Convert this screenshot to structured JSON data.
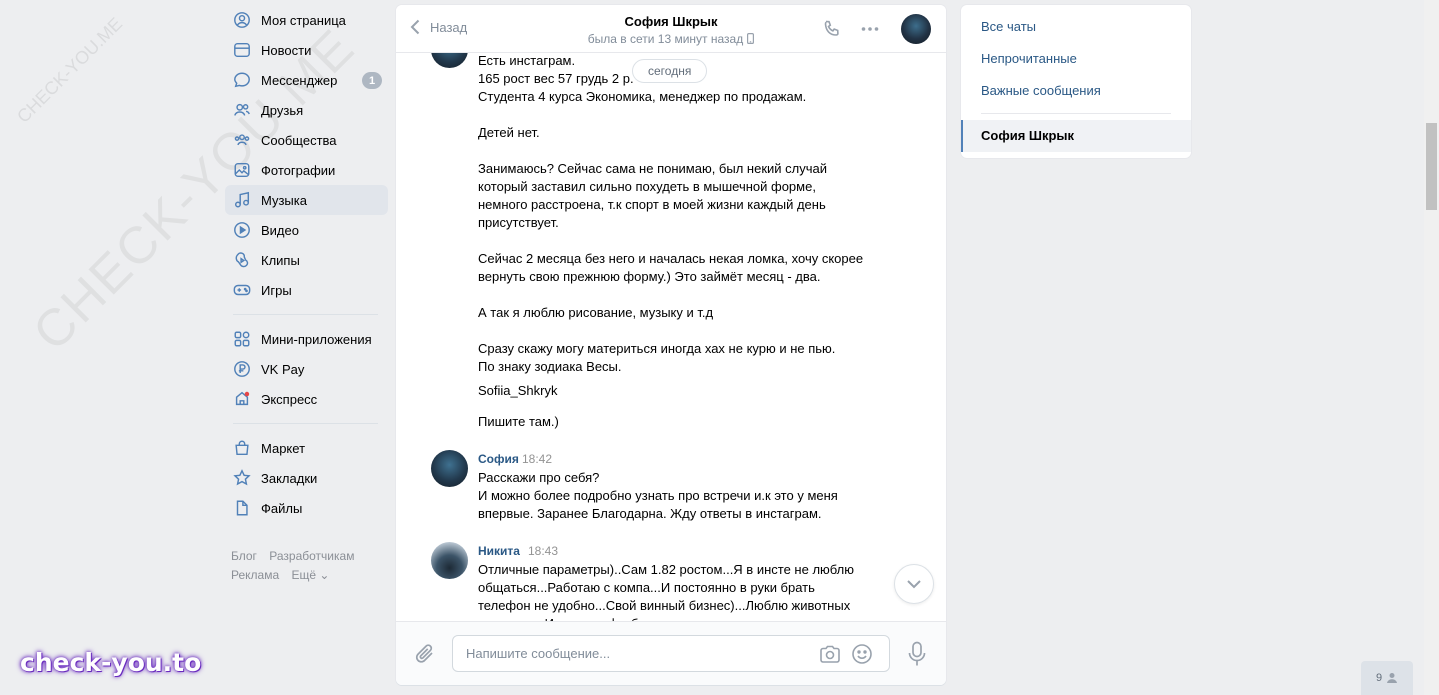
{
  "nav": {
    "items": [
      {
        "label": "Моя страница",
        "icon": "user-circle-icon"
      },
      {
        "label": "Новости",
        "icon": "news-icon"
      },
      {
        "label": "Мессенджер",
        "icon": "chat-icon",
        "badge": "1"
      },
      {
        "label": "Друзья",
        "icon": "friends-icon"
      },
      {
        "label": "Сообщества",
        "icon": "communities-icon"
      },
      {
        "label": "Фотографии",
        "icon": "photo-icon"
      },
      {
        "label": "Музыка",
        "icon": "music-icon"
      },
      {
        "label": "Видео",
        "icon": "video-icon"
      },
      {
        "label": "Клипы",
        "icon": "clips-icon"
      },
      {
        "label": "Игры",
        "icon": "gamepad-icon"
      }
    ],
    "items2": [
      {
        "label": "Мини-приложения",
        "icon": "apps-icon"
      },
      {
        "label": "VK Pay",
        "icon": "vkpay-icon"
      },
      {
        "label": "Экспресс",
        "icon": "express-icon"
      }
    ],
    "items3": [
      {
        "label": "Маркет",
        "icon": "market-icon"
      },
      {
        "label": "Закладки",
        "icon": "star-icon"
      },
      {
        "label": "Файлы",
        "icon": "file-icon"
      }
    ],
    "active": "Музыка",
    "footer": {
      "blog": "Блог",
      "dev": "Разработчикам",
      "ads": "Реклама",
      "more": "Ещё"
    }
  },
  "watermarks": {
    "big": "CHECK-YOU.ME",
    "small": "CHECK-YOU.ME",
    "brand": "check-you.to"
  },
  "chat": {
    "back_label": "Назад",
    "peer_name": "София Шкрык",
    "peer_status": "была в сети 13 минут назад",
    "date_pill": "сегодня",
    "first_message_lines": [
      "Есть инстаграм.",
      "165 рост вес 57 грудь 2 р.",
      "Студента 4 курса Экономика, менеджер по продажам.",
      "",
      "Детей нет.",
      "",
      "Занимаюсь? Сейчас сама не понимаю, был некий случай",
      "который заставил сильно похудеть в мышечной форме,",
      "немного расстроена, т.к спорт в моей жизни каждый день",
      "присутствует.",
      "",
      "Сейчас 2 месяца без него и началась некая ломка, хочу скорее",
      "вернуть свою прежнюю форму.) Это займёт месяц - два.",
      "",
      "А так я люблю рисование, музыку и т.д",
      "",
      "Сразу скажу могу материться иногда хах не курю и не пью.",
      "По знаку зодиака Весы."
    ],
    "instagram": "Sofiia_Shkryk",
    "write_there": "Пишите там.)",
    "messages": [
      {
        "author": "София",
        "time": "18:42",
        "lines": [
          "Расскажи про себя?",
          "И можно более подробно узнать про встречи и.к это у меня",
          "впервые. Заранее Благодарна. Жду ответы в инстаграм."
        ]
      },
      {
        "author": "Никита",
        "time": "18:43",
        "lines": [
          "Отличные параметры)..Сам 1.82 ростом...Я в инсте не люблю",
          "общаться...Работаю с компа...И постоянно в руки брать",
          "телефон не удобно...Свой винный бизнес)...Люблю животных",
          "и природу. Из спорта футбол."
        ]
      }
    ],
    "composer_placeholder": "Напишите сообщение..."
  },
  "rightmenu": {
    "all_chats": "Все чаты",
    "unread": "Непрочитанные",
    "important": "Важные сообщения",
    "active_chat": "София Шкрык"
  },
  "online_count": "9",
  "colors": {
    "link": "#2a5885",
    "accent": "#5181b8",
    "bg": "#edeef0"
  }
}
